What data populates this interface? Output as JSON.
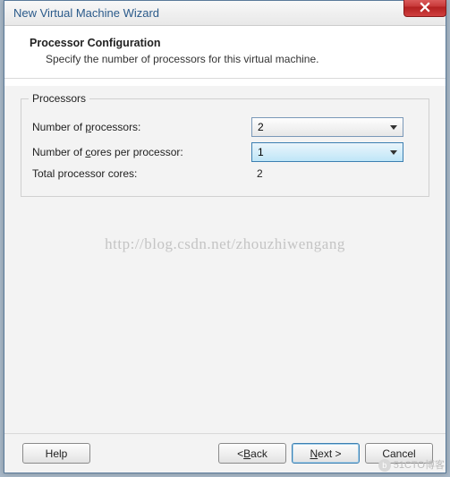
{
  "window": {
    "title": "New Virtual Machine Wizard"
  },
  "header": {
    "title": "Processor Configuration",
    "subtitle": "Specify the number of processors for this virtual machine."
  },
  "group": {
    "label": "Processors",
    "numProcessorsLabelPre": "Number of ",
    "numProcessorsHotkey": "p",
    "numProcessorsLabelPost": "rocessors:",
    "numProcessorsValue": "2",
    "numCoresLabelPre": "Number of ",
    "numCoresHotkey": "c",
    "numCoresLabelPost": "ores per processor:",
    "numCoresValue": "1",
    "totalLabel": "Total processor cores:",
    "totalValue": "2"
  },
  "footer": {
    "help": "Help",
    "backPre": "< ",
    "backHotkey": "B",
    "backPost": "ack",
    "nextHotkey": "N",
    "nextPost": "ext >",
    "cancel": "Cancel"
  },
  "watermark": "http://blog.csdn.net/zhouzhiwengang",
  "watermark2": "51CTO博客"
}
